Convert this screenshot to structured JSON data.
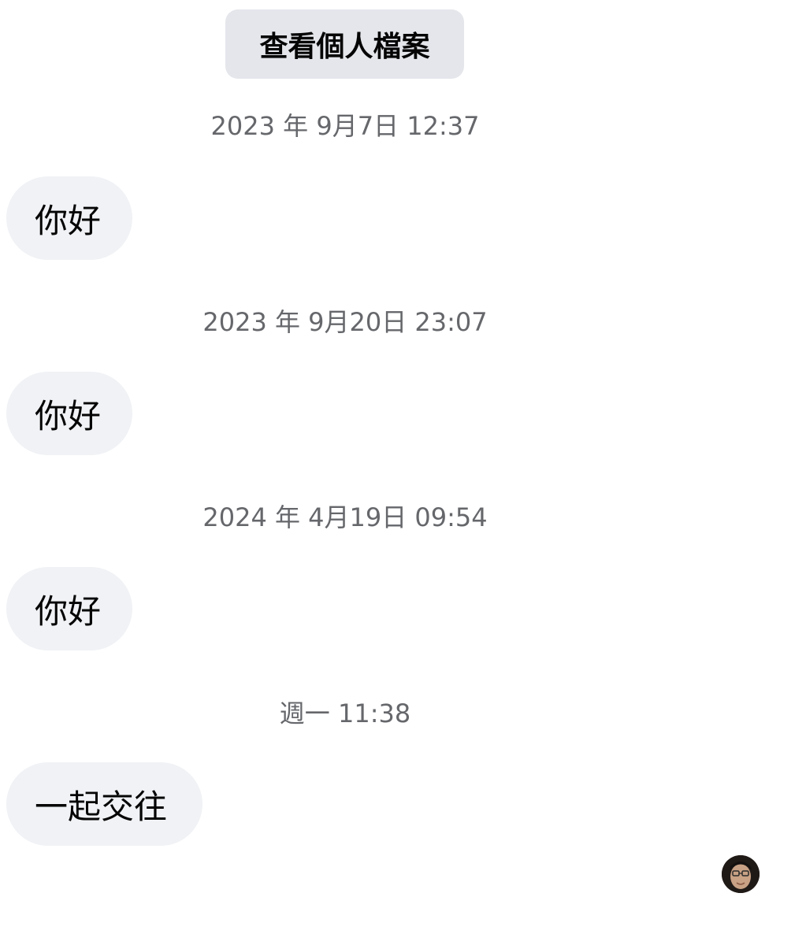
{
  "header": {
    "view_profile_label": "查看個人檔案"
  },
  "messages": [
    {
      "timestamp": "2023 年 9月7日 12:37",
      "text": "你好"
    },
    {
      "timestamp": "2023 年 9月20日 23:07",
      "text": "你好"
    },
    {
      "timestamp": "2024 年 4月19日 09:54",
      "text": "你好"
    },
    {
      "timestamp": "週一 11:38",
      "text": "一起交往"
    }
  ],
  "colors": {
    "button_bg": "#e4e6eb",
    "bubble_bg": "#f0f2f5",
    "timestamp_text": "#65676b",
    "message_text": "#050505"
  },
  "icons": {
    "seen_avatar": "user-avatar-icon"
  }
}
